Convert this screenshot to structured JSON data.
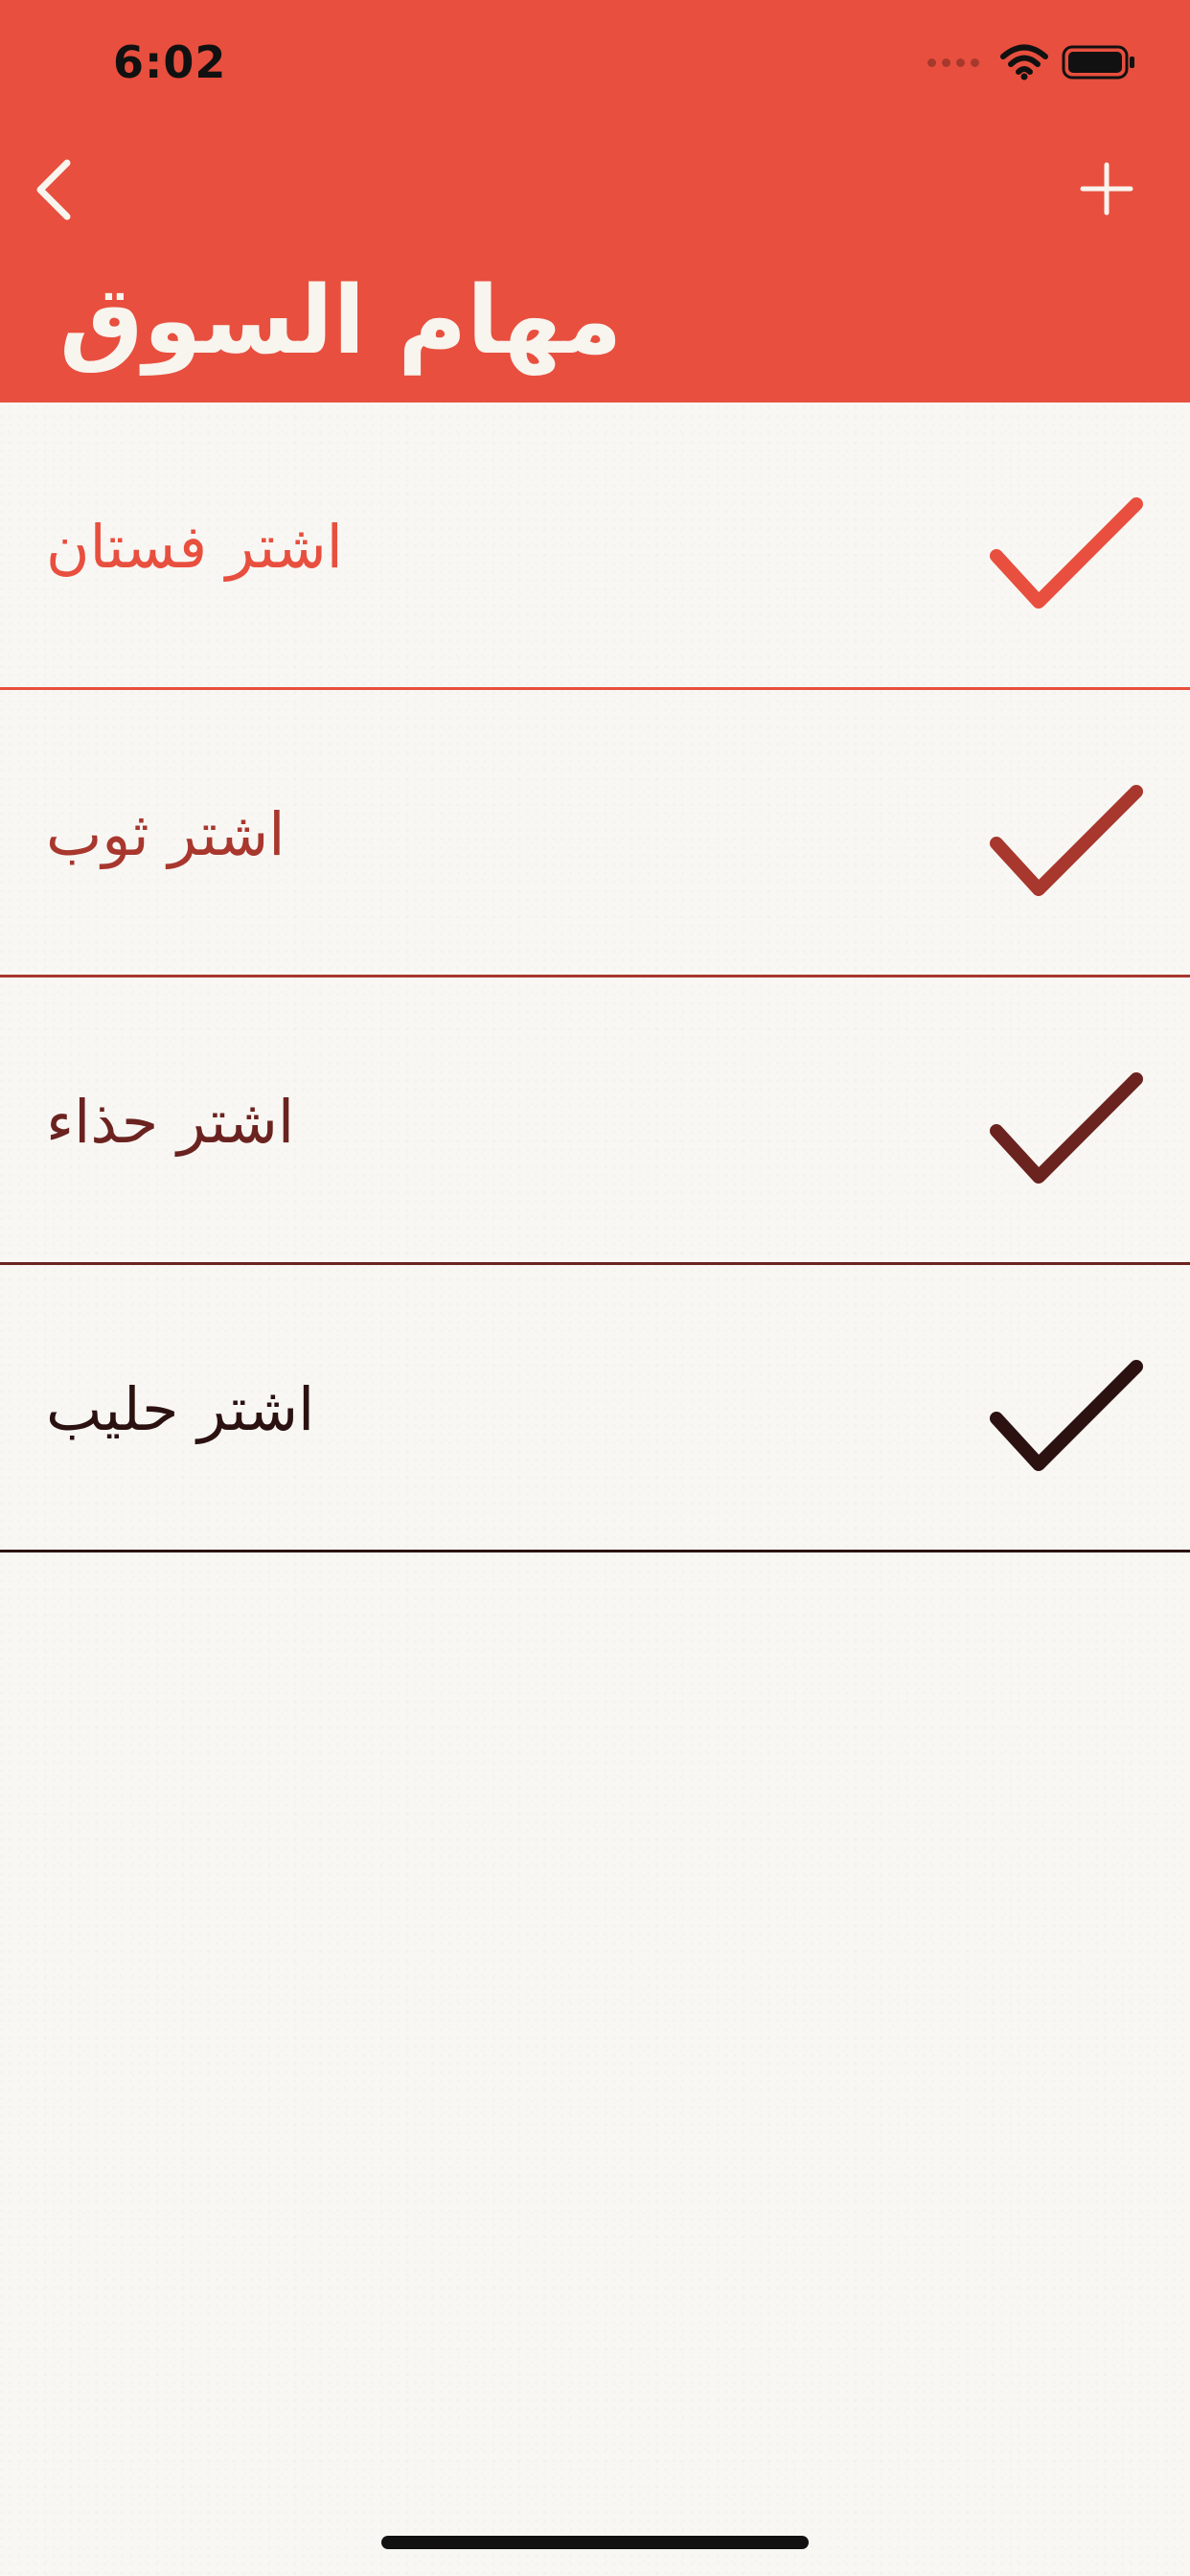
{
  "status_bar": {
    "time": "6:02"
  },
  "nav": {
    "back_icon": "chevron-left-icon",
    "add_icon": "plus-icon"
  },
  "title": "مهام السوق",
  "items": [
    {
      "label": "اشتر فستان",
      "color": "#e84f3e",
      "checked": true
    },
    {
      "label": "اشتر ثوب",
      "color": "#a8372e",
      "checked": true
    },
    {
      "label": "اشتر حذاء",
      "color": "#6b2320",
      "checked": true
    },
    {
      "label": "اشتر حليب",
      "color": "#2b1210",
      "checked": true
    }
  ],
  "colors": {
    "header": "#e84f3e",
    "background": "#f8f7f3",
    "title_text": "#f8f4ee"
  }
}
